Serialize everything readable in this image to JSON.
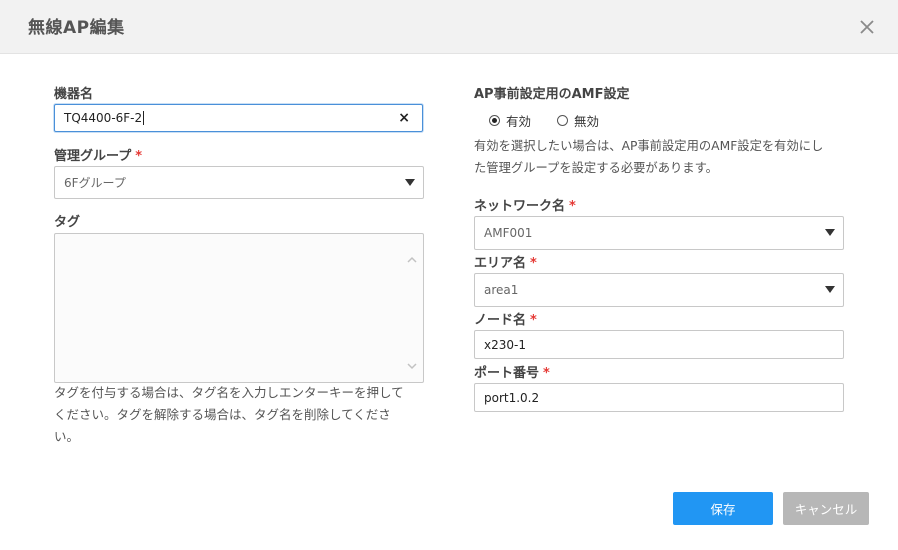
{
  "dialog": {
    "title": "無線AP編集"
  },
  "left": {
    "device_name": {
      "label": "機器名",
      "value": "TQ4400-6F-2",
      "clear_icon": "×"
    },
    "group": {
      "label": "管理グループ",
      "required_mark": "*",
      "selected": "6Fグループ"
    },
    "tag": {
      "label": "タグ",
      "value": "",
      "help_line1": "タグを付与する場合は、タグ名を入力しエンターキーを押して",
      "help_line2": "ください。タグを解除する場合は、タグ名を削除してくださ",
      "help_line3": "い。"
    }
  },
  "right": {
    "amf": {
      "label": "AP事前設定用のAMF設定",
      "options": [
        {
          "label": "有効",
          "selected": true
        },
        {
          "label": "無効",
          "selected": false
        }
      ],
      "help_line1": "有効を選択したい場合は、AP事前設定用のAMF設定を有効にし",
      "help_line2": "た管理グループを設定する必要があります。"
    },
    "network": {
      "label": "ネットワーク名",
      "required_mark": "*",
      "selected": "AMF001"
    },
    "area": {
      "label": "エリア名",
      "required_mark": "*",
      "selected": "area1"
    },
    "node": {
      "label": "ノード名",
      "required_mark": "*",
      "value": "x230-1"
    },
    "port": {
      "label": "ポート番号",
      "required_mark": "*",
      "value": "port1.0.2"
    }
  },
  "footer": {
    "save_label": "保存",
    "cancel_label": "キャンセル"
  },
  "colors": {
    "primary": "#2196f3",
    "disabled": "#b7b7b7",
    "required": "#e53935",
    "header_bg": "#f2f2f2"
  }
}
